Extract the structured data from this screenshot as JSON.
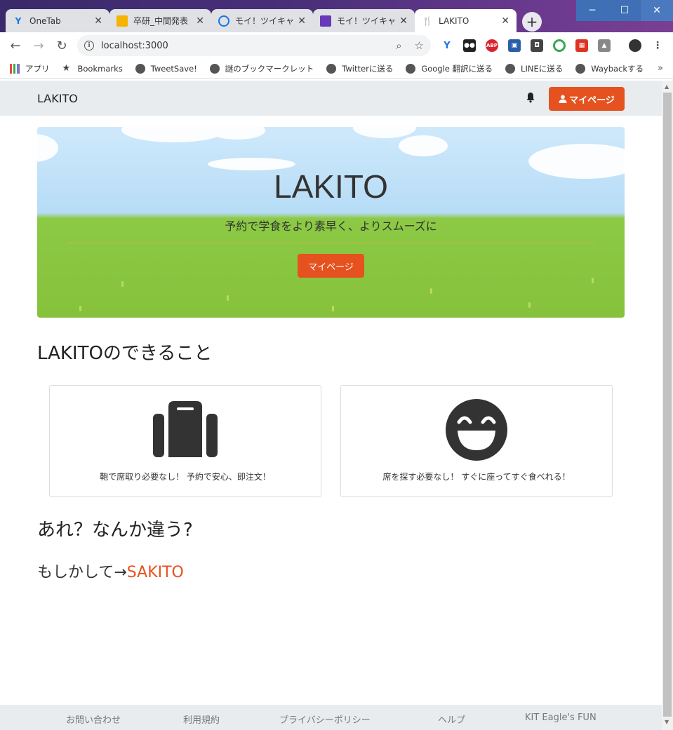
{
  "tabs": [
    {
      "label": "OneTab",
      "icon": "onetab-icon",
      "color": "#1a73e8"
    },
    {
      "label": "卒研_中間発表",
      "icon": "slides-icon",
      "color": "#f4b400"
    },
    {
      "label": "モイ！ツイキャス",
      "icon": "twitcasting-icon",
      "color": "#1a73e8"
    },
    {
      "label": "モイ！ツイキャス",
      "icon": "forms-icon",
      "color": "#673ab7"
    },
    {
      "label": "LAKITO",
      "icon": "fork-knife-icon",
      "color": "#333333"
    }
  ],
  "address": "localhost:3000",
  "bookmarks": [
    {
      "label": "アプリ",
      "icon": "apps-grid-icon"
    },
    {
      "label": "Bookmarks",
      "icon": "star-icon"
    },
    {
      "label": "TweetSave!",
      "icon": "globe-icon"
    },
    {
      "label": "謎のブックマークレット",
      "icon": "globe-icon"
    },
    {
      "label": "Twitterに送る",
      "icon": "globe-icon"
    },
    {
      "label": "Google 翻訳に送る",
      "icon": "globe-icon"
    },
    {
      "label": "LINEに送る",
      "icon": "globe-icon"
    },
    {
      "label": "Waybackする",
      "icon": "globe-icon"
    }
  ],
  "nav": {
    "brand": "LAKITO",
    "mypage": "マイページ"
  },
  "hero": {
    "title": "LAKITO",
    "subtitle": "予約で学食をより素早く、よりスムーズに",
    "button": "マイページ"
  },
  "features_title": "LAKITOのできること",
  "features": [
    {
      "icon": "suitcase-icon",
      "text": "鞄で席取り必要なし！ 予約で安心、即注文！"
    },
    {
      "icon": "laughing-face-icon",
      "text": "席を探す必要なし！ すぐに座ってすぐ食べれる！"
    }
  ],
  "wrong": {
    "title": "あれ？なんか違う?",
    "prefix": "もしかして→",
    "link": "SAKITO"
  },
  "footer": [
    "お問い合わせ",
    "利用規約",
    "プライバシーポリシー",
    "ヘルプ",
    "KIT Eagle's FUN"
  ],
  "colors": {
    "accent": "#e5521f",
    "navbar": "#e9ecef"
  }
}
